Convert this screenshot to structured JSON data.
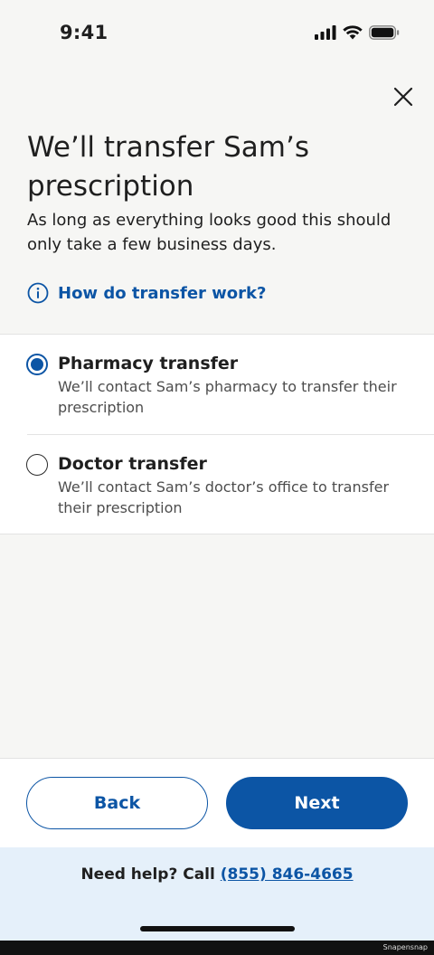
{
  "status_bar": {
    "time": "9:41"
  },
  "header": {
    "title": "We’ll transfer Sam’s prescription",
    "subtitle": "As long as everything looks good this should only take a few business days.",
    "help_link": "How do transfer work?"
  },
  "options": [
    {
      "title": "Pharmacy transfer",
      "description": "We’ll contact Sam’s pharmacy to transfer their prescription",
      "selected": true
    },
    {
      "title": "Doctor transfer",
      "description": "We’ll contact Sam’s doctor’s office to transfer their prescription",
      "selected": false
    }
  ],
  "actions": {
    "back_label": "Back",
    "next_label": "Next"
  },
  "help_footer": {
    "prefix": "Need help? Call ",
    "phone": "(855) 846-4665"
  },
  "watermark": "Snapensnap",
  "colors": {
    "primary": "#0c55a5",
    "background": "#f6f6f4",
    "footer_bg": "#e5f0fa"
  }
}
